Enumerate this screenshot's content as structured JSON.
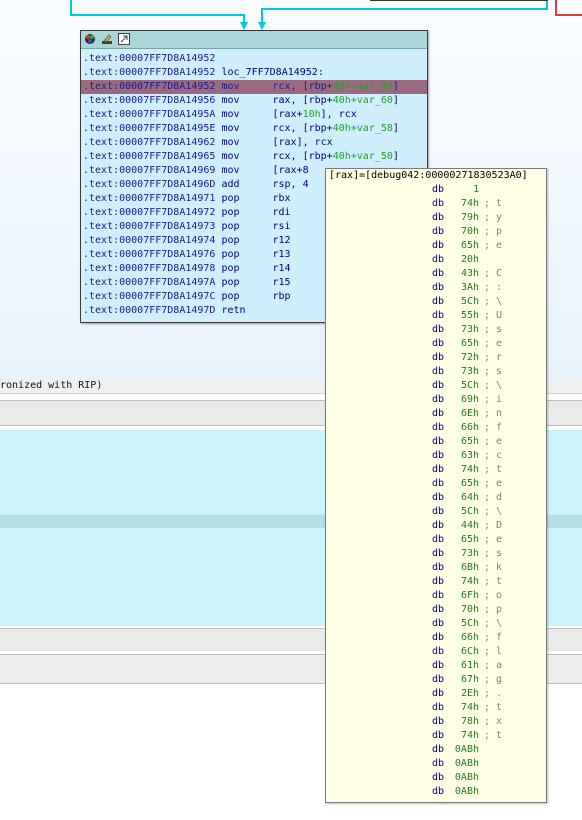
{
  "graph": {
    "node": {
      "title_icons": [
        "graph-node-color-icon",
        "graph-node-rename-icon",
        "graph-node-collapse-icon"
      ],
      "lines": [
        {
          "addr": ".text:00007FF7D8A14952",
          "mnem": "",
          "ops": "",
          "ops_green": "",
          "ops_tail": ""
        },
        {
          "addr": ".text:00007FF7D8A14952",
          "mnem": "",
          "ops": "loc_7FF7D8A14952:",
          "ops_green": "",
          "ops_tail": ""
        },
        {
          "addr": ".text:00007FF7D8A14952",
          "mnem": "mov",
          "ops": "rcx, [rbp+",
          "ops_green": "40h+var_40",
          "ops_tail": "]"
        },
        {
          "addr": ".text:00007FF7D8A14956",
          "mnem": "mov",
          "ops": "rax, [rbp+",
          "ops_green": "40h+var_60",
          "ops_tail": "]"
        },
        {
          "addr": ".text:00007FF7D8A1495A",
          "mnem": "mov",
          "ops": "[rax+",
          "ops_green": "10h",
          "ops_tail": "], rcx"
        },
        {
          "addr": ".text:00007FF7D8A1495E",
          "mnem": "mov",
          "ops": "rcx, [rbp+",
          "ops_green": "40h+var_58",
          "ops_tail": "]"
        },
        {
          "addr": ".text:00007FF7D8A14962",
          "mnem": "mov",
          "ops": "[rax], rcx",
          "ops_green": "",
          "ops_tail": ""
        },
        {
          "addr": ".text:00007FF7D8A14965",
          "mnem": "mov",
          "ops": "rcx, [rbp+",
          "ops_green": "40h+var_50",
          "ops_tail": "]"
        },
        {
          "addr": ".text:00007FF7D8A14969",
          "mnem": "mov",
          "ops": "[rax+8",
          "ops_green": "",
          "ops_tail": ""
        },
        {
          "addr": ".text:00007FF7D8A1496D",
          "mnem": "add",
          "ops": "rsp, 4",
          "ops_green": "",
          "ops_tail": ""
        },
        {
          "addr": ".text:00007FF7D8A14971",
          "mnem": "pop",
          "ops": "rbx",
          "ops_green": "",
          "ops_tail": ""
        },
        {
          "addr": ".text:00007FF7D8A14972",
          "mnem": "pop",
          "ops": "rdi",
          "ops_green": "",
          "ops_tail": ""
        },
        {
          "addr": ".text:00007FF7D8A14973",
          "mnem": "pop",
          "ops": "rsi",
          "ops_green": "",
          "ops_tail": ""
        },
        {
          "addr": ".text:00007FF7D8A14974",
          "mnem": "pop",
          "ops": "r12",
          "ops_green": "",
          "ops_tail": ""
        },
        {
          "addr": ".text:00007FF7D8A14976",
          "mnem": "pop",
          "ops": "r13",
          "ops_green": "",
          "ops_tail": ""
        },
        {
          "addr": ".text:00007FF7D8A14978",
          "mnem": "pop",
          "ops": "r14",
          "ops_green": "",
          "ops_tail": ""
        },
        {
          "addr": ".text:00007FF7D8A1497A",
          "mnem": "pop",
          "ops": "r15",
          "ops_green": "",
          "ops_tail": ""
        },
        {
          "addr": ".text:00007FF7D8A1497C",
          "mnem": "pop",
          "ops": "rbp",
          "ops_green": "",
          "ops_tail": ""
        },
        {
          "addr": ".text:00007FF7D8A1497D",
          "mnem": "retn",
          "ops": "",
          "ops_green": "",
          "ops_tail": ""
        }
      ],
      "selected_line": 2
    }
  },
  "output_line": "ronized with RIP)",
  "hint": {
    "header": "[rax]=[debug042:00000271830523A0]",
    "rows": [
      {
        "kw": "db",
        "val": "1",
        "cm": ""
      },
      {
        "kw": "db",
        "val": "74h",
        "cm": "; t"
      },
      {
        "kw": "db",
        "val": "79h",
        "cm": "; y"
      },
      {
        "kw": "db",
        "val": "70h",
        "cm": "; p"
      },
      {
        "kw": "db",
        "val": "65h",
        "cm": "; e"
      },
      {
        "kw": "db",
        "val": "20h",
        "cm": ""
      },
      {
        "kw": "db",
        "val": "43h",
        "cm": "; C"
      },
      {
        "kw": "db",
        "val": "3Ah",
        "cm": "; :"
      },
      {
        "kw": "db",
        "val": "5Ch",
        "cm": "; \\"
      },
      {
        "kw": "db",
        "val": "55h",
        "cm": "; U"
      },
      {
        "kw": "db",
        "val": "73h",
        "cm": "; s"
      },
      {
        "kw": "db",
        "val": "65h",
        "cm": "; e"
      },
      {
        "kw": "db",
        "val": "72h",
        "cm": "; r"
      },
      {
        "kw": "db",
        "val": "73h",
        "cm": "; s"
      },
      {
        "kw": "db",
        "val": "5Ch",
        "cm": "; \\"
      },
      {
        "kw": "db",
        "val": "69h",
        "cm": "; i"
      },
      {
        "kw": "db",
        "val": "6Eh",
        "cm": "; n"
      },
      {
        "kw": "db",
        "val": "66h",
        "cm": "; f"
      },
      {
        "kw": "db",
        "val": "65h",
        "cm": "; e"
      },
      {
        "kw": "db",
        "val": "63h",
        "cm": "; c"
      },
      {
        "kw": "db",
        "val": "74h",
        "cm": "; t"
      },
      {
        "kw": "db",
        "val": "65h",
        "cm": "; e"
      },
      {
        "kw": "db",
        "val": "64h",
        "cm": "; d"
      },
      {
        "kw": "db",
        "val": "5Ch",
        "cm": "; \\"
      },
      {
        "kw": "db",
        "val": "44h",
        "cm": "; D"
      },
      {
        "kw": "db",
        "val": "65h",
        "cm": "; e"
      },
      {
        "kw": "db",
        "val": "73h",
        "cm": "; s"
      },
      {
        "kw": "db",
        "val": "6Bh",
        "cm": "; k"
      },
      {
        "kw": "db",
        "val": "74h",
        "cm": "; t"
      },
      {
        "kw": "db",
        "val": "6Fh",
        "cm": "; o"
      },
      {
        "kw": "db",
        "val": "70h",
        "cm": "; p"
      },
      {
        "kw": "db",
        "val": "5Ch",
        "cm": "; \\"
      },
      {
        "kw": "db",
        "val": "66h",
        "cm": "; f"
      },
      {
        "kw": "db",
        "val": "6Ch",
        "cm": "; l"
      },
      {
        "kw": "db",
        "val": "61h",
        "cm": "; a"
      },
      {
        "kw": "db",
        "val": "67h",
        "cm": "; g"
      },
      {
        "kw": "db",
        "val": "2Eh",
        "cm": "; ."
      },
      {
        "kw": "db",
        "val": "74h",
        "cm": "; t"
      },
      {
        "kw": "db",
        "val": "78h",
        "cm": "; x"
      },
      {
        "kw": "db",
        "val": "74h",
        "cm": "; t"
      },
      {
        "kw": "db",
        "val": "0ABh",
        "cm": ""
      },
      {
        "kw": "db",
        "val": "0ABh",
        "cm": ""
      },
      {
        "kw": "db",
        "val": "0ABh",
        "cm": ""
      },
      {
        "kw": "db",
        "val": "0ABh",
        "cm": ""
      }
    ]
  },
  "colors": {
    "edge": "#00c8e0",
    "node_bg": "#cfeefe",
    "selection": "#9c6a80",
    "hint_bg": "#ffffe6",
    "hex_pane": "#caf3fb"
  }
}
